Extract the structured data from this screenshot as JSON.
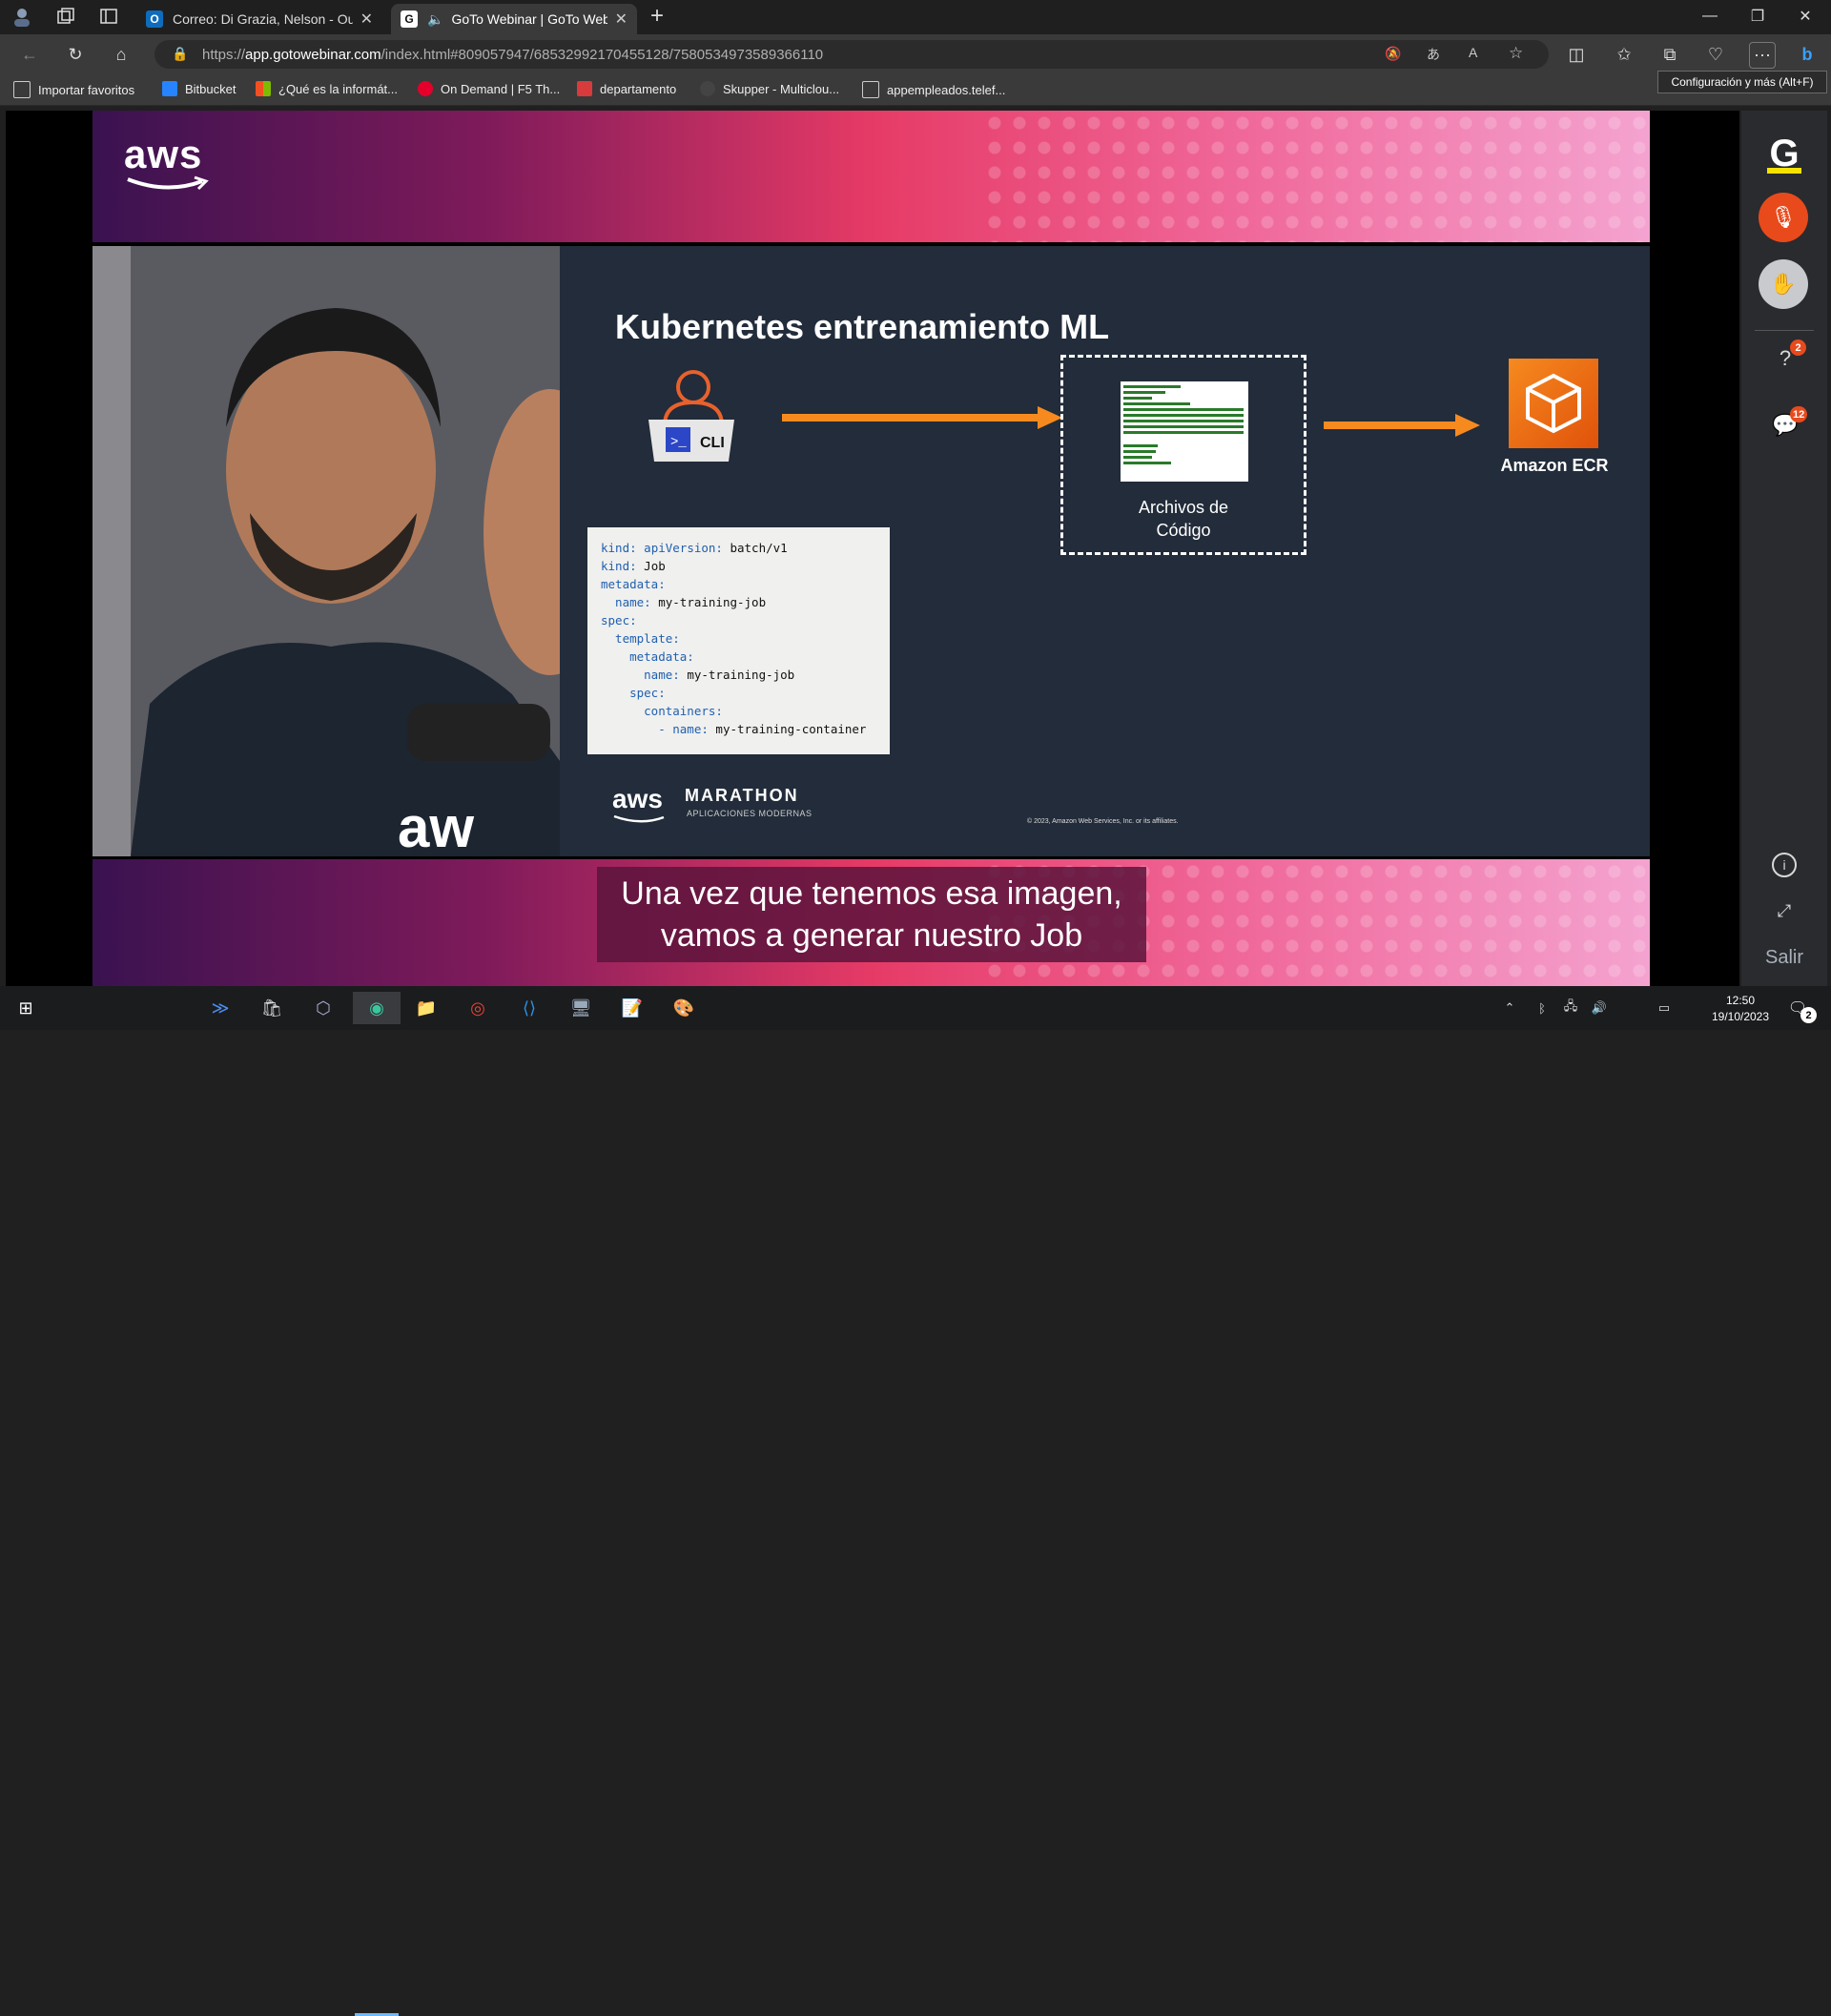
{
  "browser": {
    "tabs": [
      {
        "title": "Correo: Di Grazia, Nelson - Outlo",
        "favicon": "outlook-icon",
        "color": "#0f6cbd"
      },
      {
        "title": "GoTo Webinar | GoTo Webin",
        "favicon": "goto-icon",
        "color": "#ffffff",
        "active": true
      }
    ],
    "url_prefix": "https://",
    "url_domain": "app.gotowebinar.com",
    "url_path": "/index.html#809057947/6853299217045512​8/7580534973589366110",
    "tooltip": "Configuración y más (Alt+F)"
  },
  "bookmarks": [
    {
      "label": "Importar favoritos",
      "color": "#cccccc"
    },
    {
      "label": "Bitbucket",
      "color": "#2684ff"
    },
    {
      "label": "¿Qué es la informát...",
      "color": "#f25022"
    },
    {
      "label": "On Demand | F5 Th...",
      "color": "#e4002b"
    },
    {
      "label": "departamento",
      "color": "#d83b3b"
    },
    {
      "label": "Skupper - Multiclou...",
      "color": "#444444"
    },
    {
      "label": "appempleados.telef...",
      "color": "#cccccc"
    }
  ],
  "slide": {
    "aws_logo": "aws",
    "title": "Kubernetes entrenamiento ML",
    "cli_label": "CLI",
    "code_label_line1": "Archivos de",
    "code_label_line2": "Código",
    "ecr_label": "Amazon ECR",
    "yaml_lines": [
      [
        "kind:",
        " apiVersion:",
        " batch/v1"
      ],
      [
        "kind:",
        " Job",
        ""
      ],
      [
        "metadata:",
        "",
        ""
      ],
      [
        "  name:",
        " my-training-job",
        ""
      ],
      [
        "spec:",
        "",
        ""
      ],
      [
        "  template:",
        "",
        ""
      ],
      [
        "    metadata:",
        "",
        ""
      ],
      [
        "      name:",
        " my-training-job",
        ""
      ],
      [
        "    spec:",
        "",
        ""
      ],
      [
        "      containers:",
        "",
        ""
      ],
      [
        "        - name:",
        " my-training-container",
        ""
      ]
    ],
    "marathon_aws": "aws",
    "marathon_title": "MARATHON",
    "marathon_sub": "APLICACIONES MODERNAS",
    "copyright": "© 2023, Amazon Web Services, Inc. or its affiliates.",
    "caption_line1": "Una vez que tenemos esa imagen,",
    "caption_line2": "vamos a generar nuestro Job",
    "accent_orange": "#f68a1f"
  },
  "goto_panel": {
    "questions_badge": "2",
    "chat_badge": "12",
    "exit_label": "Salir",
    "mic_color": "#e84a1c"
  },
  "taskbar": {
    "time": "12:50",
    "date": "19/10/2023",
    "notif_count": "2"
  }
}
